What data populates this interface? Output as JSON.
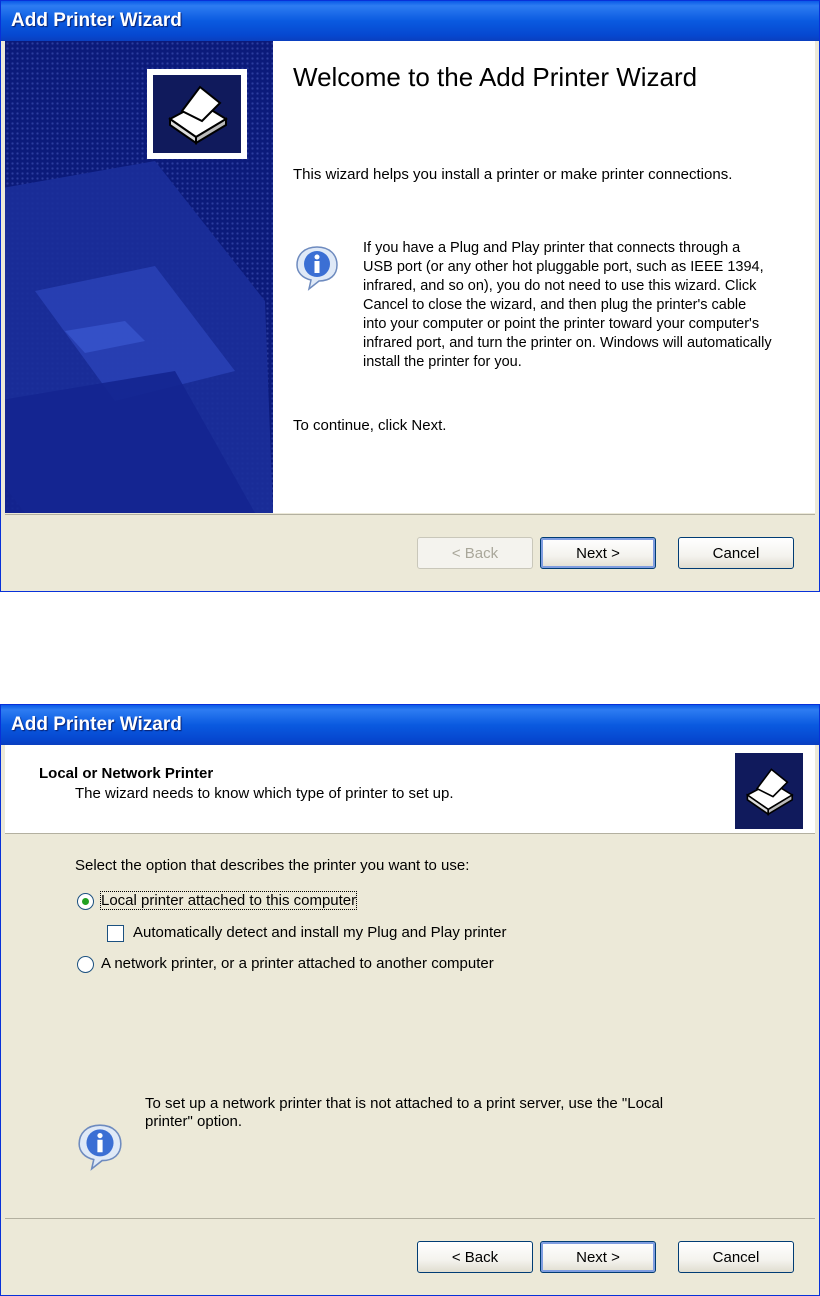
{
  "window1": {
    "title": "Add Printer Wizard",
    "welcome_title": "Welcome to the Add Printer Wizard",
    "welcome_text": "This wizard helps you install a printer or make printer connections.",
    "info_text": "If you have a Plug and Play printer that connects through a USB port (or any other hot pluggable port, such as IEEE 1394, infrared, and so on), you do not need to use this wizard. Click Cancel to close the wizard, and then plug the printer's cable into your computer or point the printer toward your computer's infrared port, and turn the printer on. Windows will automatically install the printer for you.",
    "continue_text": "To continue, click Next.",
    "buttons": {
      "back": "< Back",
      "next": "Next >",
      "cancel": "Cancel"
    },
    "back_enabled": false
  },
  "window2": {
    "title": "Add Printer Wizard",
    "header_title": "Local or Network Printer",
    "header_subtitle": "The wizard needs to know which type of printer to set up.",
    "select_label": "Select the option that describes the printer you want to use:",
    "options": {
      "local": {
        "label": "Local printer attached to this computer",
        "checked": true
      },
      "auto_detect": {
        "label": "Automatically detect and install my Plug and Play printer",
        "checked": false
      },
      "network": {
        "label": "A network printer, or a printer attached to another computer",
        "checked": false
      }
    },
    "info_text": "To set up a network printer that is not attached to a print server, use the \"Local printer\" option.",
    "buttons": {
      "back": "< Back",
      "next": "Next >",
      "cancel": "Cancel"
    },
    "back_enabled": true
  },
  "icons": [
    "printer-icon",
    "info-icon"
  ],
  "colors": {
    "titlebar": "#0a5ae0",
    "banner": "#0b1a7a",
    "dialog_bg": "#ece9d8",
    "radio_dot": "#21a121"
  }
}
